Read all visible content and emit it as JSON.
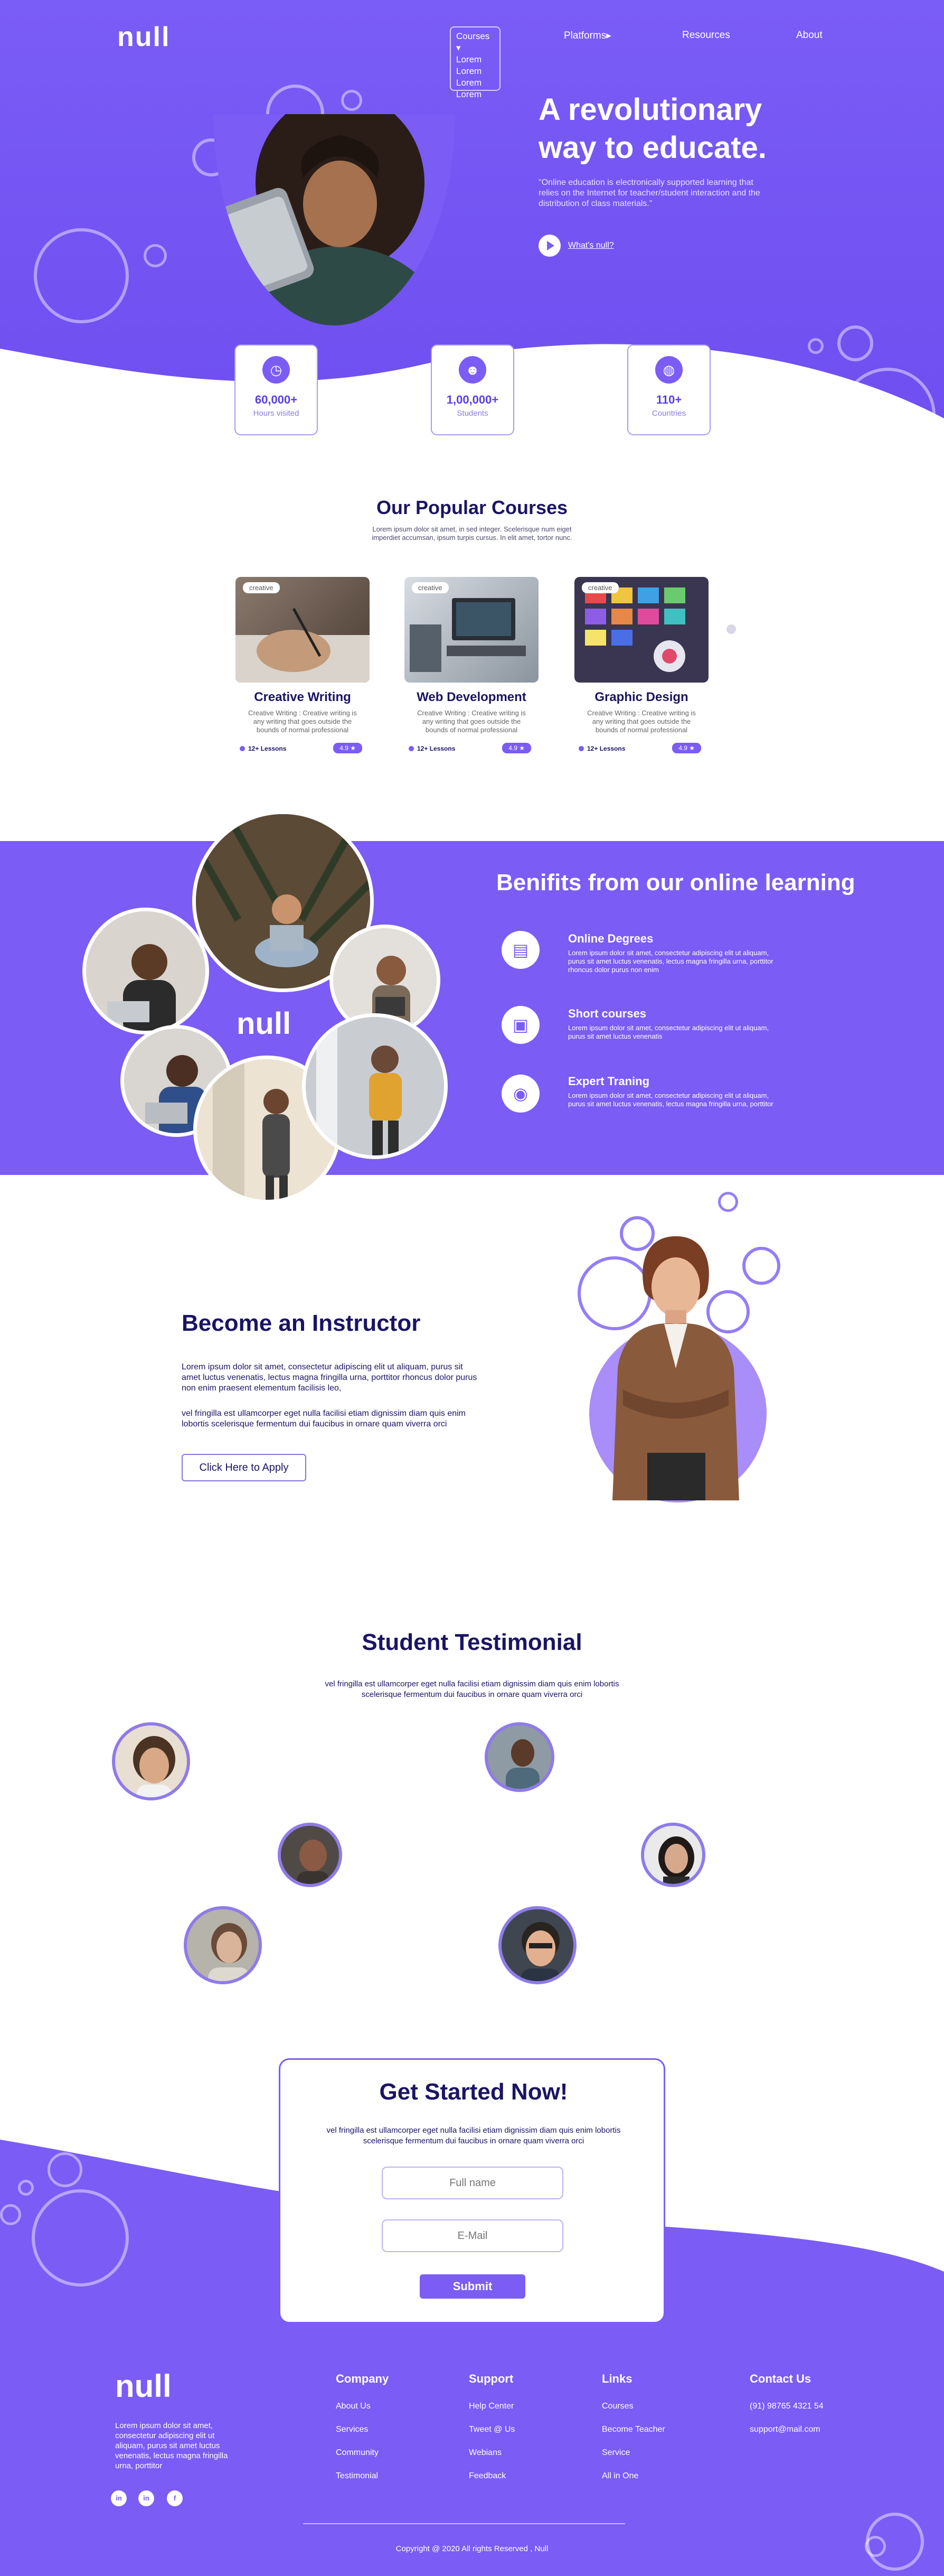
{
  "brand": {
    "logo": "null",
    "accent": "#7b5cf5",
    "navy": "#1b1464"
  },
  "nav": {
    "courses": "Courses",
    "courses_items": [
      "Lorem",
      "Lorem",
      "Lorem",
      "Lorem"
    ],
    "platforms": "Platforms",
    "resources": "Resources",
    "about": "About"
  },
  "hero": {
    "title": "A revolutionary way to educate.",
    "quote": "\"Online education is electronically supported learning that relies on the Internet for teacher/student interaction and the distribution of class materials.\"",
    "cta": "What's null?"
  },
  "stats": [
    {
      "icon": "clock-icon",
      "value": "60,000+",
      "label": "Hours visited"
    },
    {
      "icon": "students-icon",
      "value": "1,00,000+",
      "label": "Students"
    },
    {
      "icon": "globe-icon",
      "value": "110+",
      "label": "Countries"
    }
  ],
  "courses": {
    "title": "Our Popular Courses",
    "subtitle": "Lorem ipsum dolor sit amet, in sed integer. Scelerisque num eiget imperdiet accumsan, ipsum turpis cursus. In elit amet, tortor nunc.",
    "items": [
      {
        "tag": "creative",
        "title": "Creative Writing",
        "desc": "Creative Writing : Creative writing is any writing that goes outside the bounds of normal professional",
        "lessons": "12+ Lessons",
        "rating": "4.9 ★"
      },
      {
        "tag": "creative",
        "title": "Web Development",
        "desc": "Creative Writing : Creative writing is any writing that goes outside the bounds of normal professional",
        "lessons": "12+ Lessons",
        "rating": "4.9 ★"
      },
      {
        "tag": "creative",
        "title": "Graphic Design",
        "desc": "Creative Writing : Creative writing is any writing that goes outside the bounds of normal professional",
        "lessons": "12+ Lessons",
        "rating": "4.9 ★"
      }
    ]
  },
  "benefits": {
    "title": "Benifits from our online learning",
    "items": [
      {
        "icon": "certificate-icon",
        "title": "Online Degrees",
        "text": "Lorem ipsum dolor sit amet, consectetur adipiscing elit ut aliquam, purus sit amet luctus venenatis, lectus magna fringilla urna, porttitor rhoncus dolor purus non enim"
      },
      {
        "icon": "book-icon",
        "title": "Short courses",
        "text": "Lorem ipsum dolor sit amet, consectetur adipiscing elit ut aliquam, purus sit amet luctus venenatis"
      },
      {
        "icon": "expert-icon",
        "title": "Expert Traning",
        "text": "Lorem ipsum dolor sit amet, consectetur adipiscing elit ut aliquam, purus sit amet luctus venenatis, lectus magna fringilla urna, porttitor"
      }
    ]
  },
  "instructor": {
    "title": "Become an Instructor",
    "p1": "Lorem ipsum dolor sit amet, consectetur adipiscing elit ut aliquam, purus sit amet luctus venenatis, lectus magna fringilla urna, porttitor rhoncus dolor purus non enim praesent elementum facilisis leo,",
    "p2": "vel fringilla est ullamcorper eget nulla facilisi etiam dignissim diam quis enim lobortis scelerisque fermentum dui faucibus in ornare quam viverra orci",
    "button": "Click Here to Apply"
  },
  "testimonial": {
    "title": "Student Testimonial",
    "subtitle": "vel fringilla est ullamcorper eget nulla facilisi etiam dignissim diam quis enim lobortis scelerisque fermentum dui faucibus in ornare quam viverra orci"
  },
  "get_started": {
    "title": "Get Started Now!",
    "subtitle": "vel fringilla est ullamcorper eget nulla facilisi etiam dignissim diam quis enim lobortis scelerisque fermentum dui faucibus in ornare quam viverra orci",
    "name_placeholder": "Full name",
    "email_placeholder": "E-Mail",
    "submit": "Submit"
  },
  "footer": {
    "about": "Lorem ipsum dolor sit amet, consectetur adipiscing elit ut aliquam, purus sit amet luctus venenatis, lectus magna fringilla urna, porttitor",
    "company": {
      "title": "Company",
      "links": [
        "About Us",
        "Services",
        "Community",
        "Testimonial"
      ]
    },
    "support": {
      "title": "Support",
      "links": [
        "Help Center",
        "Tweet @ Us",
        "Webians",
        "Feedback"
      ]
    },
    "links": {
      "title": "Links",
      "links": [
        "Courses",
        "Become Teacher",
        "Service",
        "All in One"
      ]
    },
    "contact": {
      "title": "Contact Us",
      "phone": "(91) 98765 4321 54",
      "email": "support@mail.com"
    },
    "social": [
      "linkedin-icon",
      "linkedin-icon",
      "facebook-icon"
    ],
    "copyright": "Copyright @ 2020 All rights Reserved , Null"
  }
}
